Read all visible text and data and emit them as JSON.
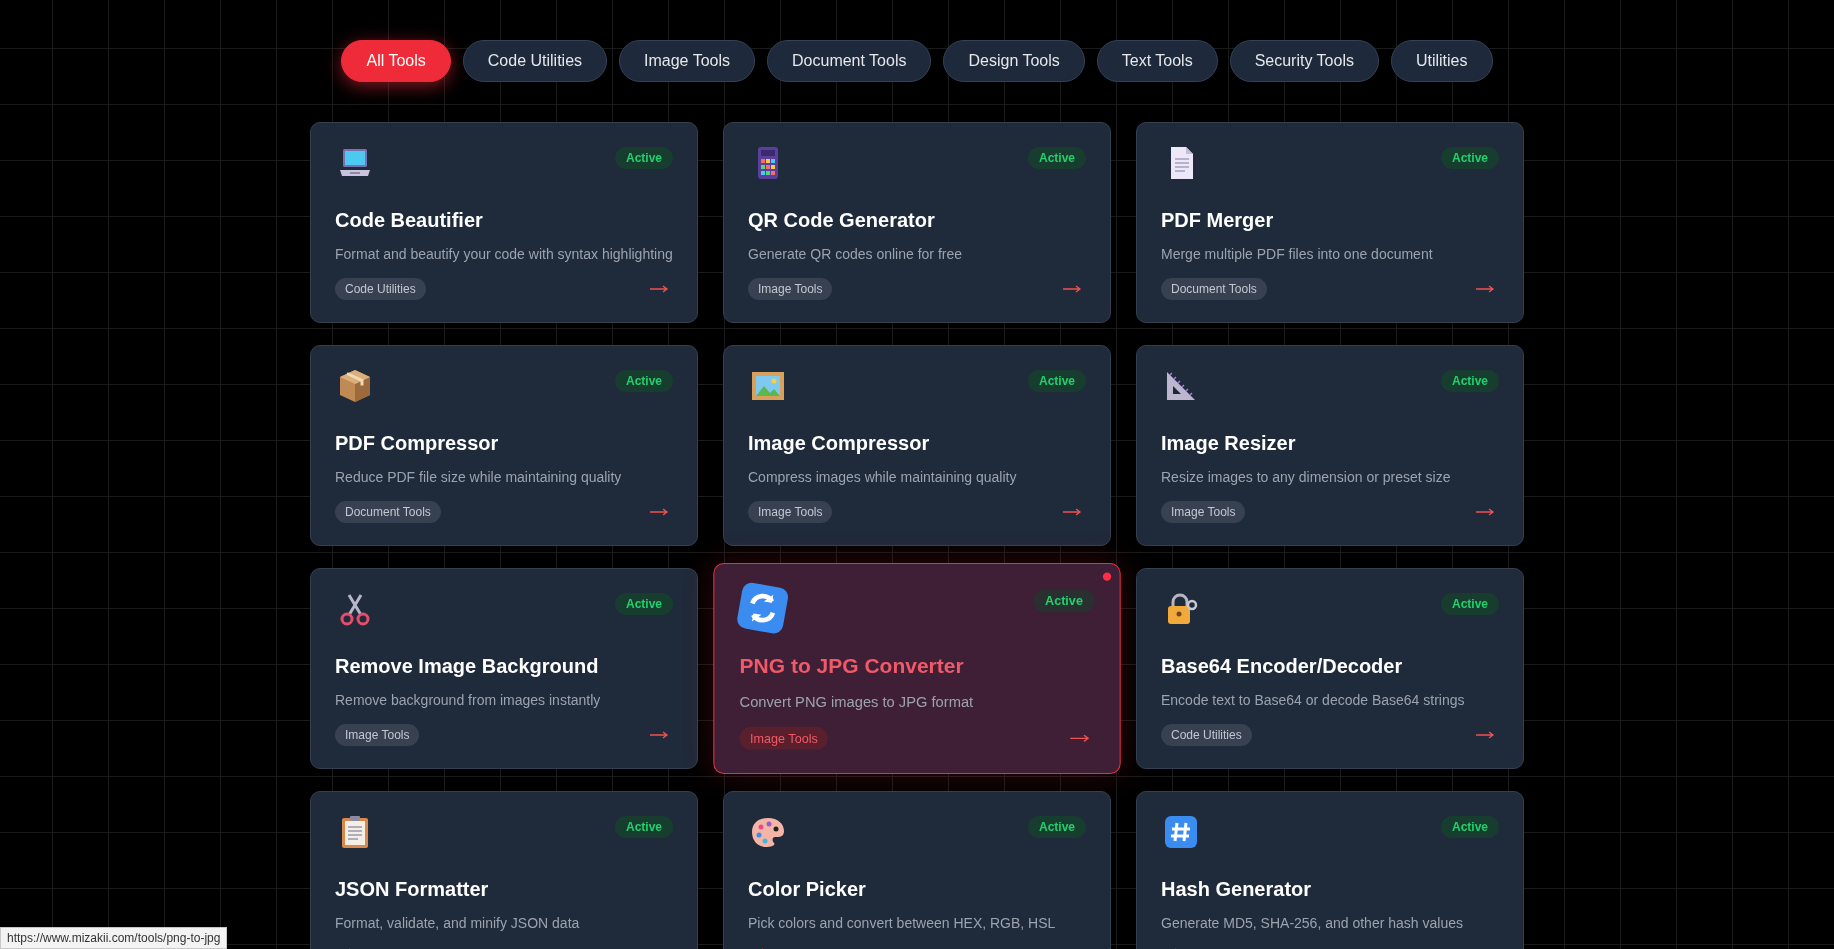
{
  "tabs": [
    {
      "label": "All Tools",
      "selected": true
    },
    {
      "label": "Code Utilities",
      "selected": false
    },
    {
      "label": "Image Tools",
      "selected": false
    },
    {
      "label": "Document Tools",
      "selected": false
    },
    {
      "label": "Design Tools",
      "selected": false
    },
    {
      "label": "Text Tools",
      "selected": false
    },
    {
      "label": "Security Tools",
      "selected": false
    },
    {
      "label": "Utilities",
      "selected": false
    }
  ],
  "cards": [
    {
      "title": "Code Beautifier",
      "description": "Format and beautify your code with syntax highlighting",
      "category": "Code Utilities",
      "status": "Active",
      "highlighted": false
    },
    {
      "title": "QR Code Generator",
      "description": "Generate QR codes online for free",
      "category": "Image Tools",
      "status": "Active",
      "highlighted": false
    },
    {
      "title": "PDF Merger",
      "description": "Merge multiple PDF files into one document",
      "category": "Document Tools",
      "status": "Active",
      "highlighted": false
    },
    {
      "title": "PDF Compressor",
      "description": "Reduce PDF file size while maintaining quality",
      "category": "Document Tools",
      "status": "Active",
      "highlighted": false
    },
    {
      "title": "Image Compressor",
      "description": "Compress images while maintaining quality",
      "category": "Image Tools",
      "status": "Active",
      "highlighted": false
    },
    {
      "title": "Image Resizer",
      "description": "Resize images to any dimension or preset size",
      "category": "Image Tools",
      "status": "Active",
      "highlighted": false
    },
    {
      "title": "Remove Image Background",
      "description": "Remove background from images instantly",
      "category": "Image Tools",
      "status": "Active",
      "highlighted": false
    },
    {
      "title": "PNG to JPG Converter",
      "description": "Convert PNG images to JPG format",
      "category": "Image Tools",
      "status": "Active",
      "highlighted": true
    },
    {
      "title": "Base64 Encoder/Decoder",
      "description": "Encode text to Base64 or decode Base64 strings",
      "category": "Code Utilities",
      "status": "Active",
      "highlighted": false
    },
    {
      "title": "JSON Formatter",
      "description": "Format, validate, and minify JSON data",
      "status": "Active",
      "highlighted": false
    },
    {
      "title": "Color Picker",
      "description": "Pick colors and convert between HEX, RGB, HSL",
      "status": "Active",
      "highlighted": false
    },
    {
      "title": "Hash Generator",
      "description": "Generate MD5, SHA-256, and other hash values",
      "status": "Active",
      "highlighted": false
    }
  ],
  "status_bar": {
    "url": "https://www.mizakii.com/tools/png-to-jpg"
  }
}
